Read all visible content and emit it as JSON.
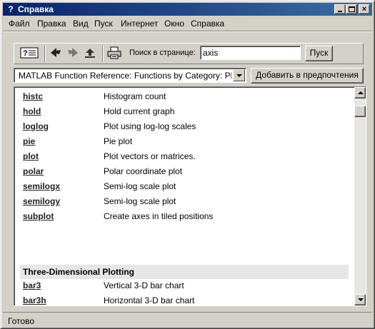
{
  "window": {
    "title": "Справка",
    "app_icon_glyph": "?",
    "controls": {
      "minimize": "",
      "maximize": "",
      "close": "×"
    }
  },
  "menu": [
    "Файл",
    "Правка",
    "Вид",
    "Пуск",
    "Интернет",
    "Окно",
    "Справка"
  ],
  "toolbar": {
    "icons": [
      "help-navigator-icon",
      "back-arrow-icon",
      "forward-arrow-icon",
      "reload-icon",
      "print-icon"
    ],
    "search_label": "Поиск в странице:",
    "search_value": "axis",
    "go_label": "Пуск"
  },
  "location": {
    "value": "MATLAB Function Reference: Functions by Category: Plotting and Data Visualization",
    "add_favorites_label": "Добавить в предпочтения"
  },
  "functions": [
    {
      "name": "histc",
      "desc": "Histogram count"
    },
    {
      "name": "hold",
      "desc": "Hold current graph"
    },
    {
      "name": "loglog",
      "desc": "Plot using log-log scales"
    },
    {
      "name": "pie",
      "desc": "Pie plot"
    },
    {
      "name": "plot",
      "desc": "Plot vectors or matrices."
    },
    {
      "name": "polar",
      "desc": "Polar coordinate plot"
    },
    {
      "name": "semilogx",
      "desc": "Semi-log scale plot"
    },
    {
      "name": "semilogy",
      "desc": "Semi-log scale plot"
    },
    {
      "name": "subplot",
      "desc": "Create axes in tiled positions"
    }
  ],
  "section": {
    "title": "Three-Dimensional Plotting",
    "items": [
      {
        "name": "bar3",
        "desc": "Vertical 3-D bar chart"
      },
      {
        "name": "bar3h",
        "desc": "Horizontal 3-D bar chart"
      }
    ]
  },
  "status": "Готово",
  "colors": {
    "titlebar_start": "#0a246a",
    "titlebar_end": "#3a6ea5",
    "face": "#d4d0c8"
  }
}
